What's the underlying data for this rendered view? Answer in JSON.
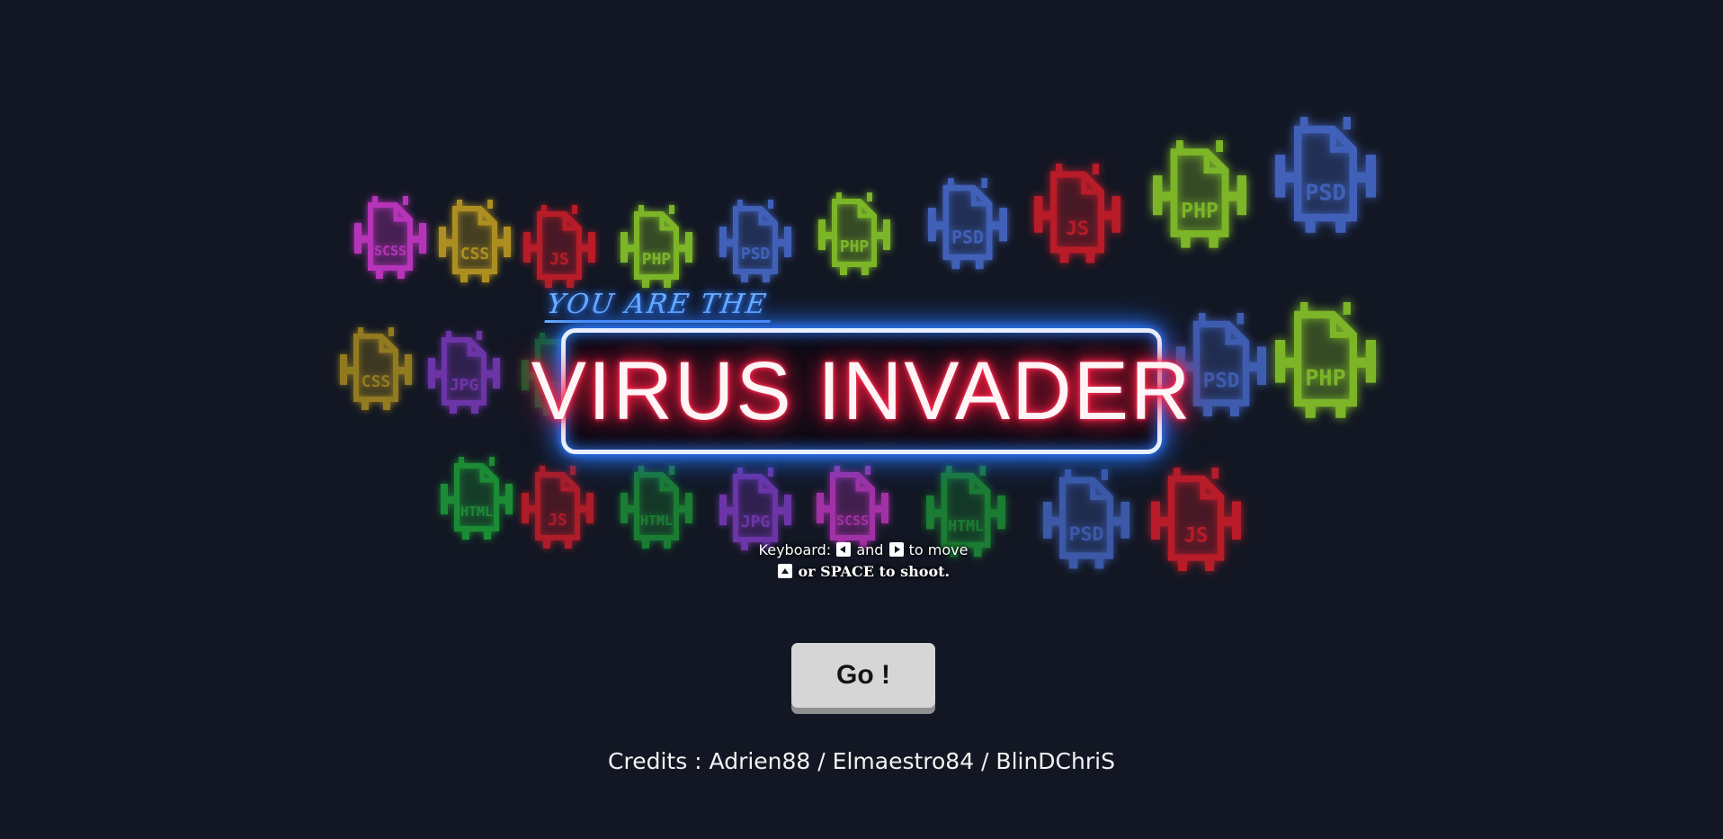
{
  "title": {
    "tagline": "YOU ARE THE",
    "main": "VIRUS INVADER"
  },
  "instructions": {
    "line1_prefix": "Keyboard:",
    "line1_and": "and",
    "line1_suffix": "to move",
    "line2": "or SPACE to shoot."
  },
  "go_button": {
    "label": "Go !"
  },
  "credits": {
    "text": "Credits : Adrien88 / Elmaestro84 / BlinDChriS"
  },
  "colors": {
    "background": "#121723",
    "title_glow": "#ff1f45",
    "frame_glow": "#2f7cff",
    "tagline": "#6fb0ff"
  },
  "invaders": [
    {
      "label": "SCSS",
      "color": "#d23ad2",
      "opacity": 0.85
    },
    {
      "label": "CSS",
      "color": "#c9a421",
      "opacity": 0.85
    },
    {
      "label": "JS",
      "color": "#d41e2a",
      "opacity": 0.85
    },
    {
      "label": "PHP",
      "color": "#8fd12a",
      "opacity": 0.85
    },
    {
      "label": "PSD",
      "color": "#4a6fd4",
      "opacity": 0.85
    },
    {
      "label": "PHP",
      "color": "#8fd12a",
      "opacity": 0.85
    },
    {
      "label": "PSD",
      "color": "#4a6fd4",
      "opacity": 0.85
    },
    {
      "label": "JS",
      "color": "#d41e2a",
      "opacity": 0.85
    },
    {
      "label": "PHP",
      "color": "#8fd12a",
      "opacity": 0.85
    },
    {
      "label": "PSD",
      "color": "#4a6fd4",
      "opacity": 0.85
    },
    {
      "label": "CSS",
      "color": "#c9a421",
      "opacity": 0.7
    },
    {
      "label": "JPG",
      "color": "#8a3fd4",
      "opacity": 0.75
    },
    {
      "label": "HTML",
      "color": "#1fa83a",
      "opacity": 0.5
    },
    {
      "label": "PSD",
      "color": "#4a6fd4",
      "opacity": 0.8
    },
    {
      "label": "PHP",
      "color": "#8fd12a",
      "opacity": 0.85
    },
    {
      "label": "HTML",
      "color": "#1fa83a",
      "opacity": 0.8
    },
    {
      "label": "JS",
      "color": "#d41e2a",
      "opacity": 0.8
    },
    {
      "label": "HTML",
      "color": "#1fa83a",
      "opacity": 0.7
    },
    {
      "label": "JPG",
      "color": "#8a3fd4",
      "opacity": 0.75
    },
    {
      "label": "SCSS",
      "color": "#d23ad2",
      "opacity": 0.75
    },
    {
      "label": "HTML",
      "color": "#1fa83a",
      "opacity": 0.7
    },
    {
      "label": "PSD",
      "color": "#4a6fd4",
      "opacity": 0.75
    },
    {
      "label": "JS",
      "color": "#d41e2a",
      "opacity": 0.85
    }
  ]
}
